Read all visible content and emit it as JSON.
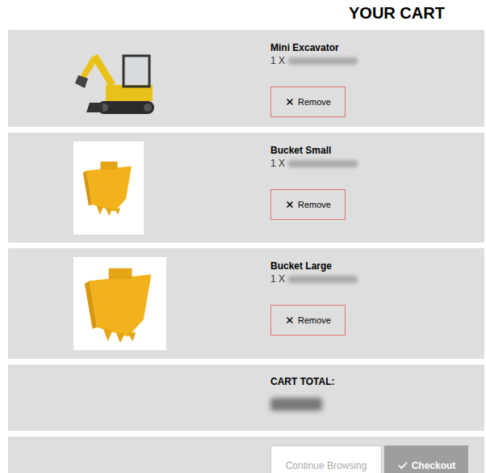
{
  "heading": "YOUR CART",
  "items": [
    {
      "name": "Mini Excavator",
      "quantity": "1 X",
      "price_blurred": true,
      "remove_label": "Remove",
      "kind": "excavator"
    },
    {
      "name": "Bucket Small",
      "quantity": "1 X",
      "price_blurred": true,
      "remove_label": "Remove",
      "kind": "bucket-small"
    },
    {
      "name": "Bucket Large",
      "quantity": "1 X",
      "price_blurred": true,
      "remove_label": "Remove",
      "kind": "bucket-large"
    }
  ],
  "total": {
    "label": "CART TOTAL:",
    "amount_blurred": true
  },
  "buttons": [
    {
      "label": "Continue Browsing",
      "kind": "secondary"
    },
    {
      "label": "Checkout",
      "kind": "primary"
    }
  ]
}
